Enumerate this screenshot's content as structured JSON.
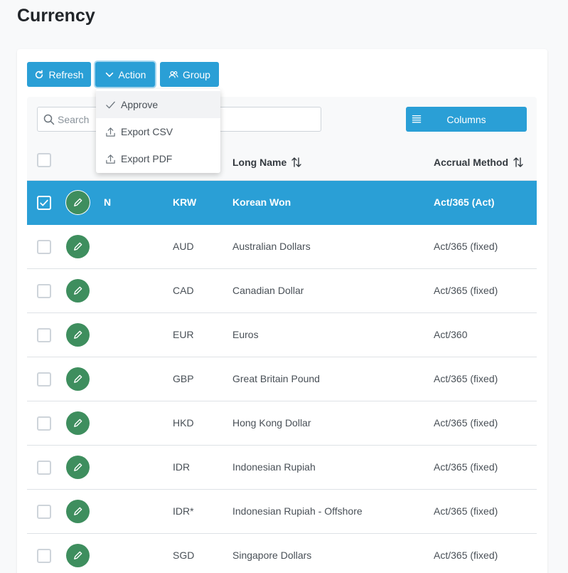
{
  "page": {
    "title": "Currency"
  },
  "toolbar": {
    "refresh_label": "Refresh",
    "action_label": "Action",
    "group_label": "Group",
    "columns_label": "Columns",
    "search_placeholder": "Search"
  },
  "action_menu": {
    "items": [
      {
        "label": "Approve",
        "icon": "check-icon"
      },
      {
        "label": "Export CSV",
        "icon": "upload-icon"
      },
      {
        "label": "Export PDF",
        "icon": "upload-icon"
      }
    ]
  },
  "table": {
    "headers": {
      "long_name": "Long Name",
      "accrual_method": "Accrual Method"
    },
    "rows": [
      {
        "flag": "N",
        "code": "KRW",
        "long_name": "Korean Won",
        "accrual": "Act/365 (Act)",
        "selected": true
      },
      {
        "flag": "",
        "code": "AUD",
        "long_name": "Australian Dollars",
        "accrual": "Act/365 (fixed)",
        "selected": false
      },
      {
        "flag": "",
        "code": "CAD",
        "long_name": "Canadian Dollar",
        "accrual": "Act/365 (fixed)",
        "selected": false
      },
      {
        "flag": "",
        "code": "EUR",
        "long_name": "Euros",
        "accrual": "Act/360",
        "selected": false
      },
      {
        "flag": "",
        "code": "GBP",
        "long_name": "Great Britain Pound",
        "accrual": "Act/365 (fixed)",
        "selected": false
      },
      {
        "flag": "",
        "code": "HKD",
        "long_name": "Hong Kong Dollar",
        "accrual": "Act/365 (fixed)",
        "selected": false
      },
      {
        "flag": "",
        "code": "IDR",
        "long_name": "Indonesian Rupiah",
        "accrual": "Act/365 (fixed)",
        "selected": false
      },
      {
        "flag": "",
        "code": "IDR*",
        "long_name": "Indonesian Rupiah - Offshore",
        "accrual": "Act/365 (fixed)",
        "selected": false
      },
      {
        "flag": "",
        "code": "SGD",
        "long_name": "Singapore Dollars",
        "accrual": "Act/365 (fixed)",
        "selected": false
      }
    ]
  },
  "colors": {
    "primary": "#2a9fd6",
    "edit_button": "#3e8e5e",
    "page_background": "#f8f9fa"
  }
}
